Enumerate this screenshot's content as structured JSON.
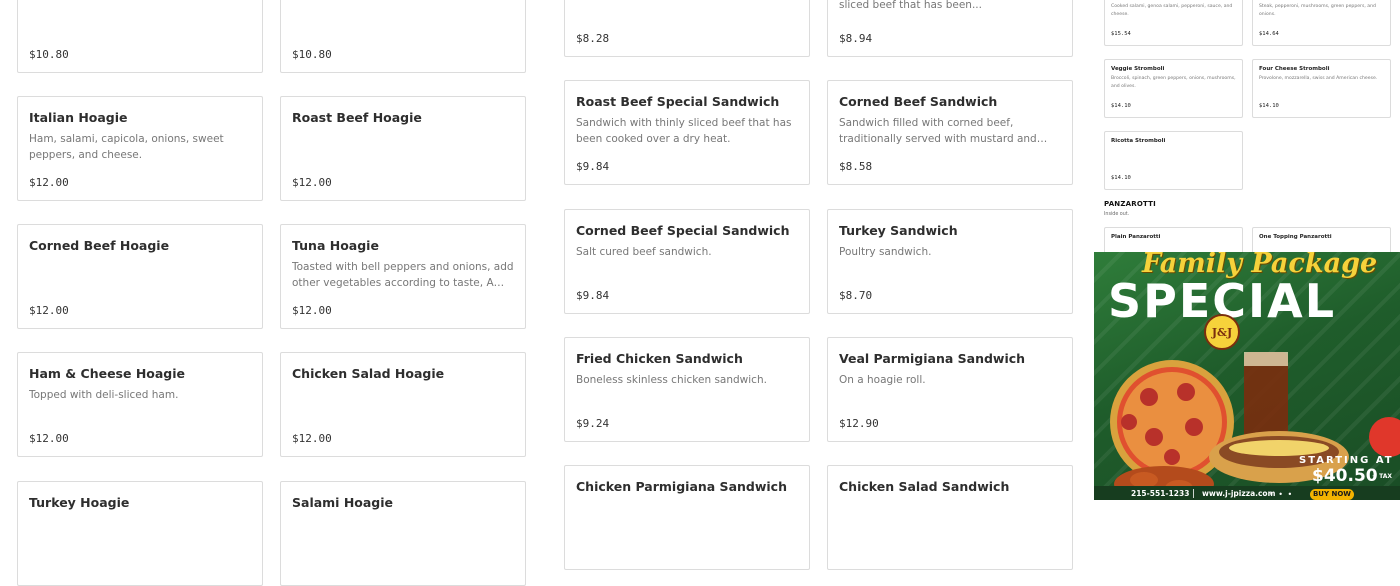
{
  "col1": [
    {
      "name": "",
      "desc": "",
      "price": "$10.80"
    },
    {
      "name": "Italian Hoagie",
      "desc": "Ham, salami, capicola, onions, sweet peppers, and cheese.",
      "price": "$12.00"
    },
    {
      "name": "Corned Beef Hoagie",
      "desc": "",
      "price": "$12.00"
    },
    {
      "name": "Ham & Cheese Hoagie",
      "desc": "Topped with deli-sliced ham.",
      "price": "$12.00"
    },
    {
      "name": "Turkey Hoagie",
      "desc": "",
      "price": ""
    }
  ],
  "col2": [
    {
      "name": "",
      "desc": "",
      "price": "$10.80"
    },
    {
      "name": "Roast Beef Hoagie",
      "desc": "",
      "price": "$12.00"
    },
    {
      "name": "Tuna Hoagie",
      "desc": "Toasted with bell peppers and onions, add other vegetables according to taste, A squirt of sweet...",
      "price": "$12.00"
    },
    {
      "name": "Chicken Salad Hoagie",
      "desc": "",
      "price": "$12.00"
    },
    {
      "name": "Salami Hoagie",
      "desc": "",
      "price": ""
    }
  ],
  "col3": [
    {
      "name": "",
      "desc": "",
      "price": "$8.28"
    },
    {
      "name": "Roast Beef Special Sandwich",
      "desc": "Sandwich with thinly sliced beef that has been cooked over a dry heat.",
      "price": "$9.84"
    },
    {
      "name": "Corned Beef Special Sandwich",
      "desc": "Salt cured beef sandwich.",
      "price": "$9.84"
    },
    {
      "name": "Fried Chicken Sandwich",
      "desc": "Boneless skinless chicken sandwich.",
      "price": "$9.24"
    },
    {
      "name": "Chicken Parmigiana Sandwich",
      "desc": "",
      "price": ""
    }
  ],
  "col4": [
    {
      "name": "",
      "desc": "sliced beef that has been...",
      "price": "$8.94"
    },
    {
      "name": "Corned Beef Sandwich",
      "desc": "Sandwich filled with corned beef, traditionally served with mustard and pickles.",
      "price": "$8.58"
    },
    {
      "name": "Turkey Sandwich",
      "desc": "Poultry sandwich.",
      "price": "$8.70"
    },
    {
      "name": "Veal Parmigiana Sandwich",
      "desc": "On a hoagie roll.",
      "price": "$12.90"
    },
    {
      "name": "Chicken Salad Sandwich",
      "desc": "",
      "price": ""
    }
  ],
  "mini": {
    "top_left": {
      "name": "",
      "desc": "Cooked salami, genoa salami, pepperoni, sauce, and cheese.",
      "price": "$15.54"
    },
    "top_right": {
      "name": "",
      "desc": "Steak, pepperoni, mushrooms, green peppers, and onions.",
      "price": "$14.64"
    },
    "veggie": {
      "name": "Veggie Stromboli",
      "desc": "Broccoli, spinach, green peppers, onions, mushrooms, and olives.",
      "price": "$14.10"
    },
    "four_cheese": {
      "name": "Four Cheese Stromboli",
      "desc": "Provolone, mozzarella, swiss and American cheese.",
      "price": "$14.10"
    },
    "ricotta": {
      "name": "Ricotta Stromboli",
      "desc": "",
      "price": "$14.10"
    },
    "panzarotti_title": "PANZAROTTI",
    "panzarotti_sub": "Inside out.",
    "plain_panzarotti": "Plain Panzarotti",
    "one_topping_panzarotti": "One Topping Panzarotti"
  },
  "ad": {
    "family": "Family Package",
    "special": "SPECIAL",
    "logo": "J&J",
    "starting_at": "STARTING AT",
    "price": "$40.50",
    "tax": "+ TAX",
    "phone": "215-551-1233",
    "separator": "|",
    "site": "www.j-jpizza.com",
    "dots": "• • •",
    "buy_now": "BUY NOW"
  },
  "colors": {
    "card_border": "#dcdcdc",
    "ad_green": "#2f7d3a",
    "ad_yellow": "#f6d23b",
    "buy_button": "#f4b400"
  }
}
